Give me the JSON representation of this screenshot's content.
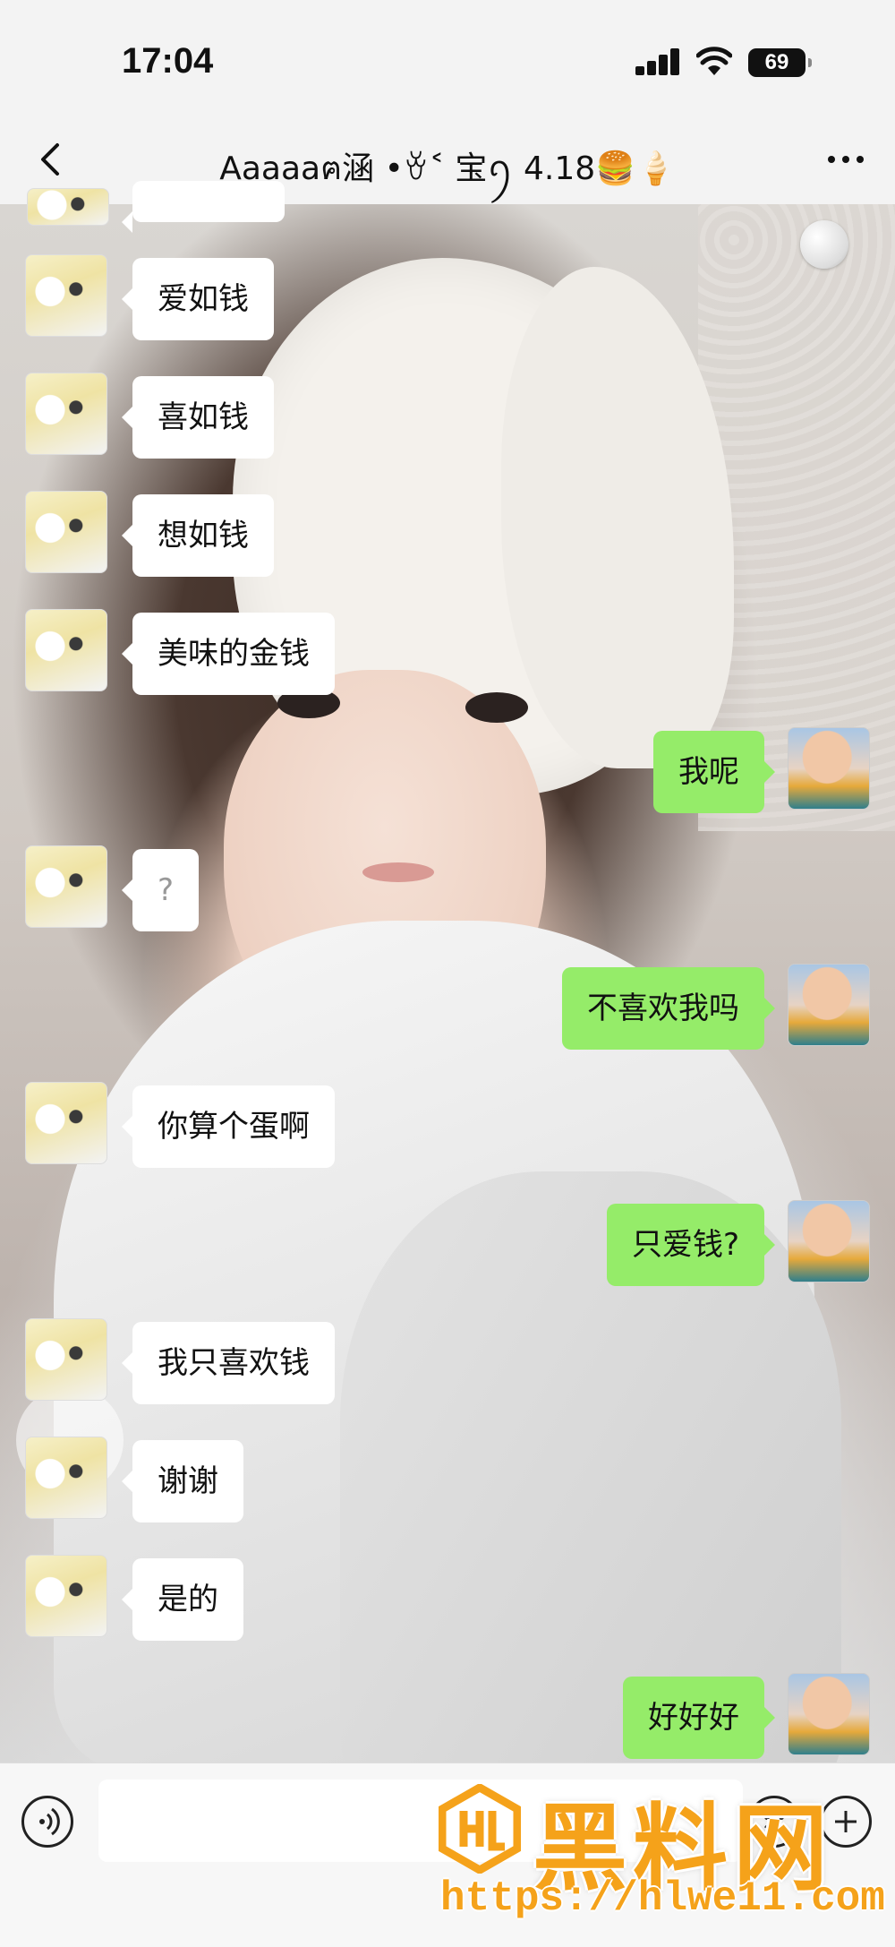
{
  "status_bar": {
    "time": "17:04",
    "battery": "69"
  },
  "nav": {
    "title": "Aaaaaฅ涵 •ꈊ˂ 宝ꪆ 4.18🍔🍦",
    "back_icon": "chevron-left-icon",
    "more_icon": "more-dots-icon"
  },
  "messages": [
    {
      "side": "in",
      "text": "爱如钱"
    },
    {
      "side": "in",
      "text": "喜如钱"
    },
    {
      "side": "in",
      "text": "想如钱"
    },
    {
      "side": "in",
      "text": "美味的金钱"
    },
    {
      "side": "out",
      "text": "我呢"
    },
    {
      "side": "in",
      "text": "?"
    },
    {
      "side": "out",
      "text": "不喜欢我吗"
    },
    {
      "side": "in",
      "text": "你算个蛋啊"
    },
    {
      "side": "out",
      "text": "只爱钱?"
    },
    {
      "side": "in",
      "text": "我只喜欢钱"
    },
    {
      "side": "in",
      "text": "谢谢"
    },
    {
      "side": "in",
      "text": "是的"
    },
    {
      "side": "out",
      "text": "好好好"
    }
  ],
  "input_bar": {
    "voice_icon": "voice-icon",
    "emoji_icon": "emoji-icon",
    "plus_icon": "plus-icon",
    "value": ""
  },
  "watermark": {
    "brand": "黑料网",
    "url": "https://hlwe11.com"
  },
  "colors": {
    "outgoing_bubble": "#95ec69",
    "incoming_bubble": "#ffffff",
    "watermark": "#f5a21a"
  }
}
